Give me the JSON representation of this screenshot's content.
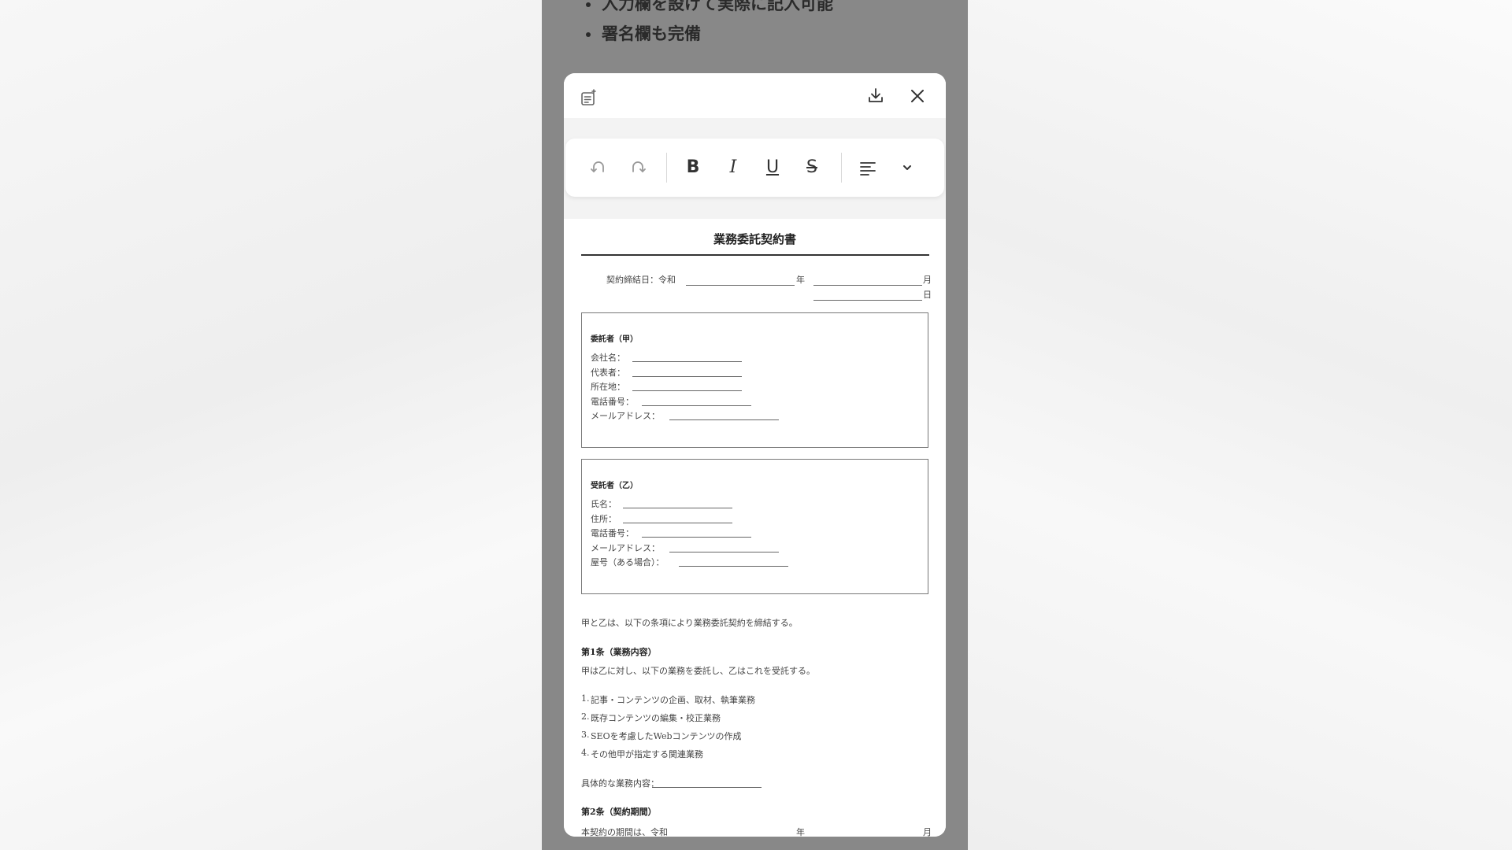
{
  "background": {
    "bullets": [
      "入力欄を設けて実際に記入可能",
      "署名欄も完備"
    ]
  },
  "modal": {
    "header": {
      "edit_icon": "edit-note-icon",
      "download_icon": "download-icon",
      "close_icon": "close-icon"
    },
    "toolbar": {
      "undo_icon": "undo-icon",
      "redo_icon": "redo-icon",
      "bold": "B",
      "italic": "I",
      "underline": "U",
      "strike": "S",
      "align_icon": "align-left-icon",
      "more_icon": "chevron-down-icon"
    }
  },
  "document": {
    "title": "業務委託契約書",
    "date_label": "契約締結日：令和",
    "year": "年",
    "month": "月",
    "day": "日",
    "consignor": {
      "heading": "委託者（甲）",
      "fields": [
        "会社名：",
        "代表者：",
        "所在地：",
        "電話番号：",
        "メールアドレス："
      ]
    },
    "consignee": {
      "heading": "受託者（乙）",
      "fields": [
        "氏名：",
        "住所：",
        "電話番号：",
        "メールアドレス：",
        "屋号（ある場合）："
      ]
    },
    "intro": "甲と乙は、以下の条項により業務委託契約を締結する。",
    "article1": {
      "heading": "第1条（業務内容）",
      "text": "甲は乙に対し、以下の業務を委託し、乙はこれを受託する。",
      "items": [
        "記事・コンテンツの企画、取材、執筆業務",
        "既存コンテンツの編集・校正業務",
        "SEOを考慮したWebコンテンツの作成",
        "その他甲が指定する関連業務"
      ],
      "detail_label": "具体的な業務内容："
    },
    "article2": {
      "heading": "第2条（契約期間）",
      "text": "本契約の期間は、令和",
      "year": "年",
      "month": "月"
    }
  }
}
